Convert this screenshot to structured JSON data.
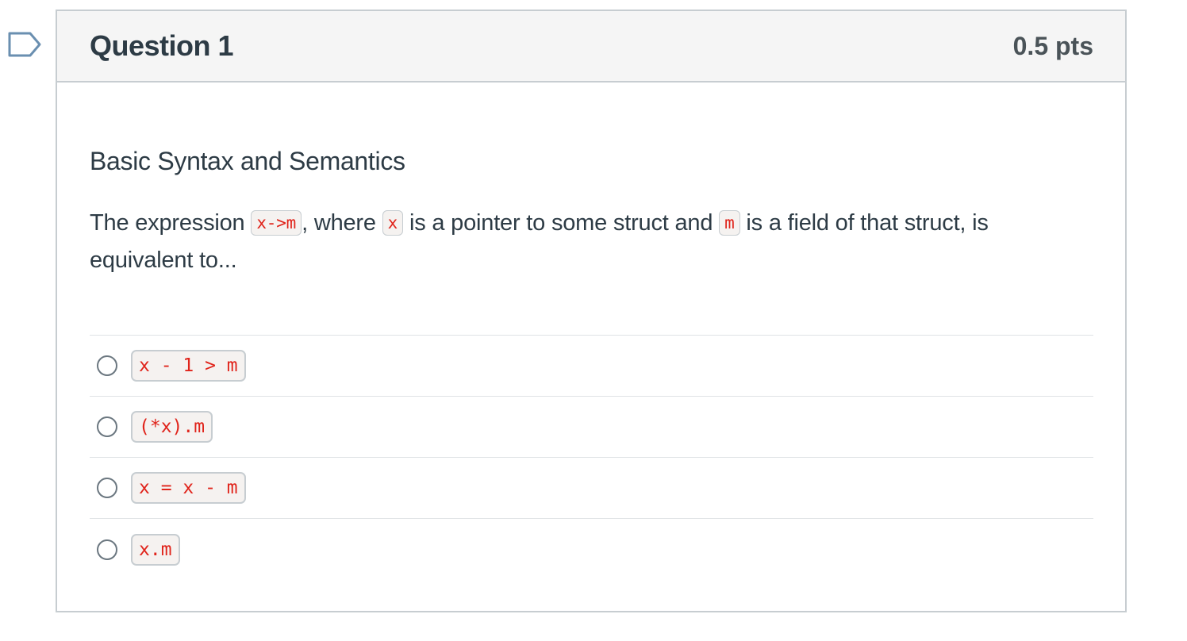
{
  "flag": {
    "icon": "bookmark-flag-icon",
    "color": "#6a8fb0"
  },
  "question": {
    "title": "Question 1",
    "points": "0.5 pts",
    "heading": "Basic Syntax and Semantics",
    "text": {
      "part1": "The expression ",
      "code1": "x->m",
      "part2": ", where ",
      "code2": "x",
      "part3": " is a pointer to some struct and ",
      "code3": "m",
      "part4": " is a field of that struct, is equivalent to..."
    },
    "answers": [
      {
        "code": "x - 1 > m"
      },
      {
        "code": "(*x).m"
      },
      {
        "code": "x = x - m"
      },
      {
        "code": "x.m"
      }
    ]
  },
  "colors": {
    "code_text": "#e0241b",
    "border": "#c7cdd1",
    "header_bg": "#f5f5f5"
  }
}
